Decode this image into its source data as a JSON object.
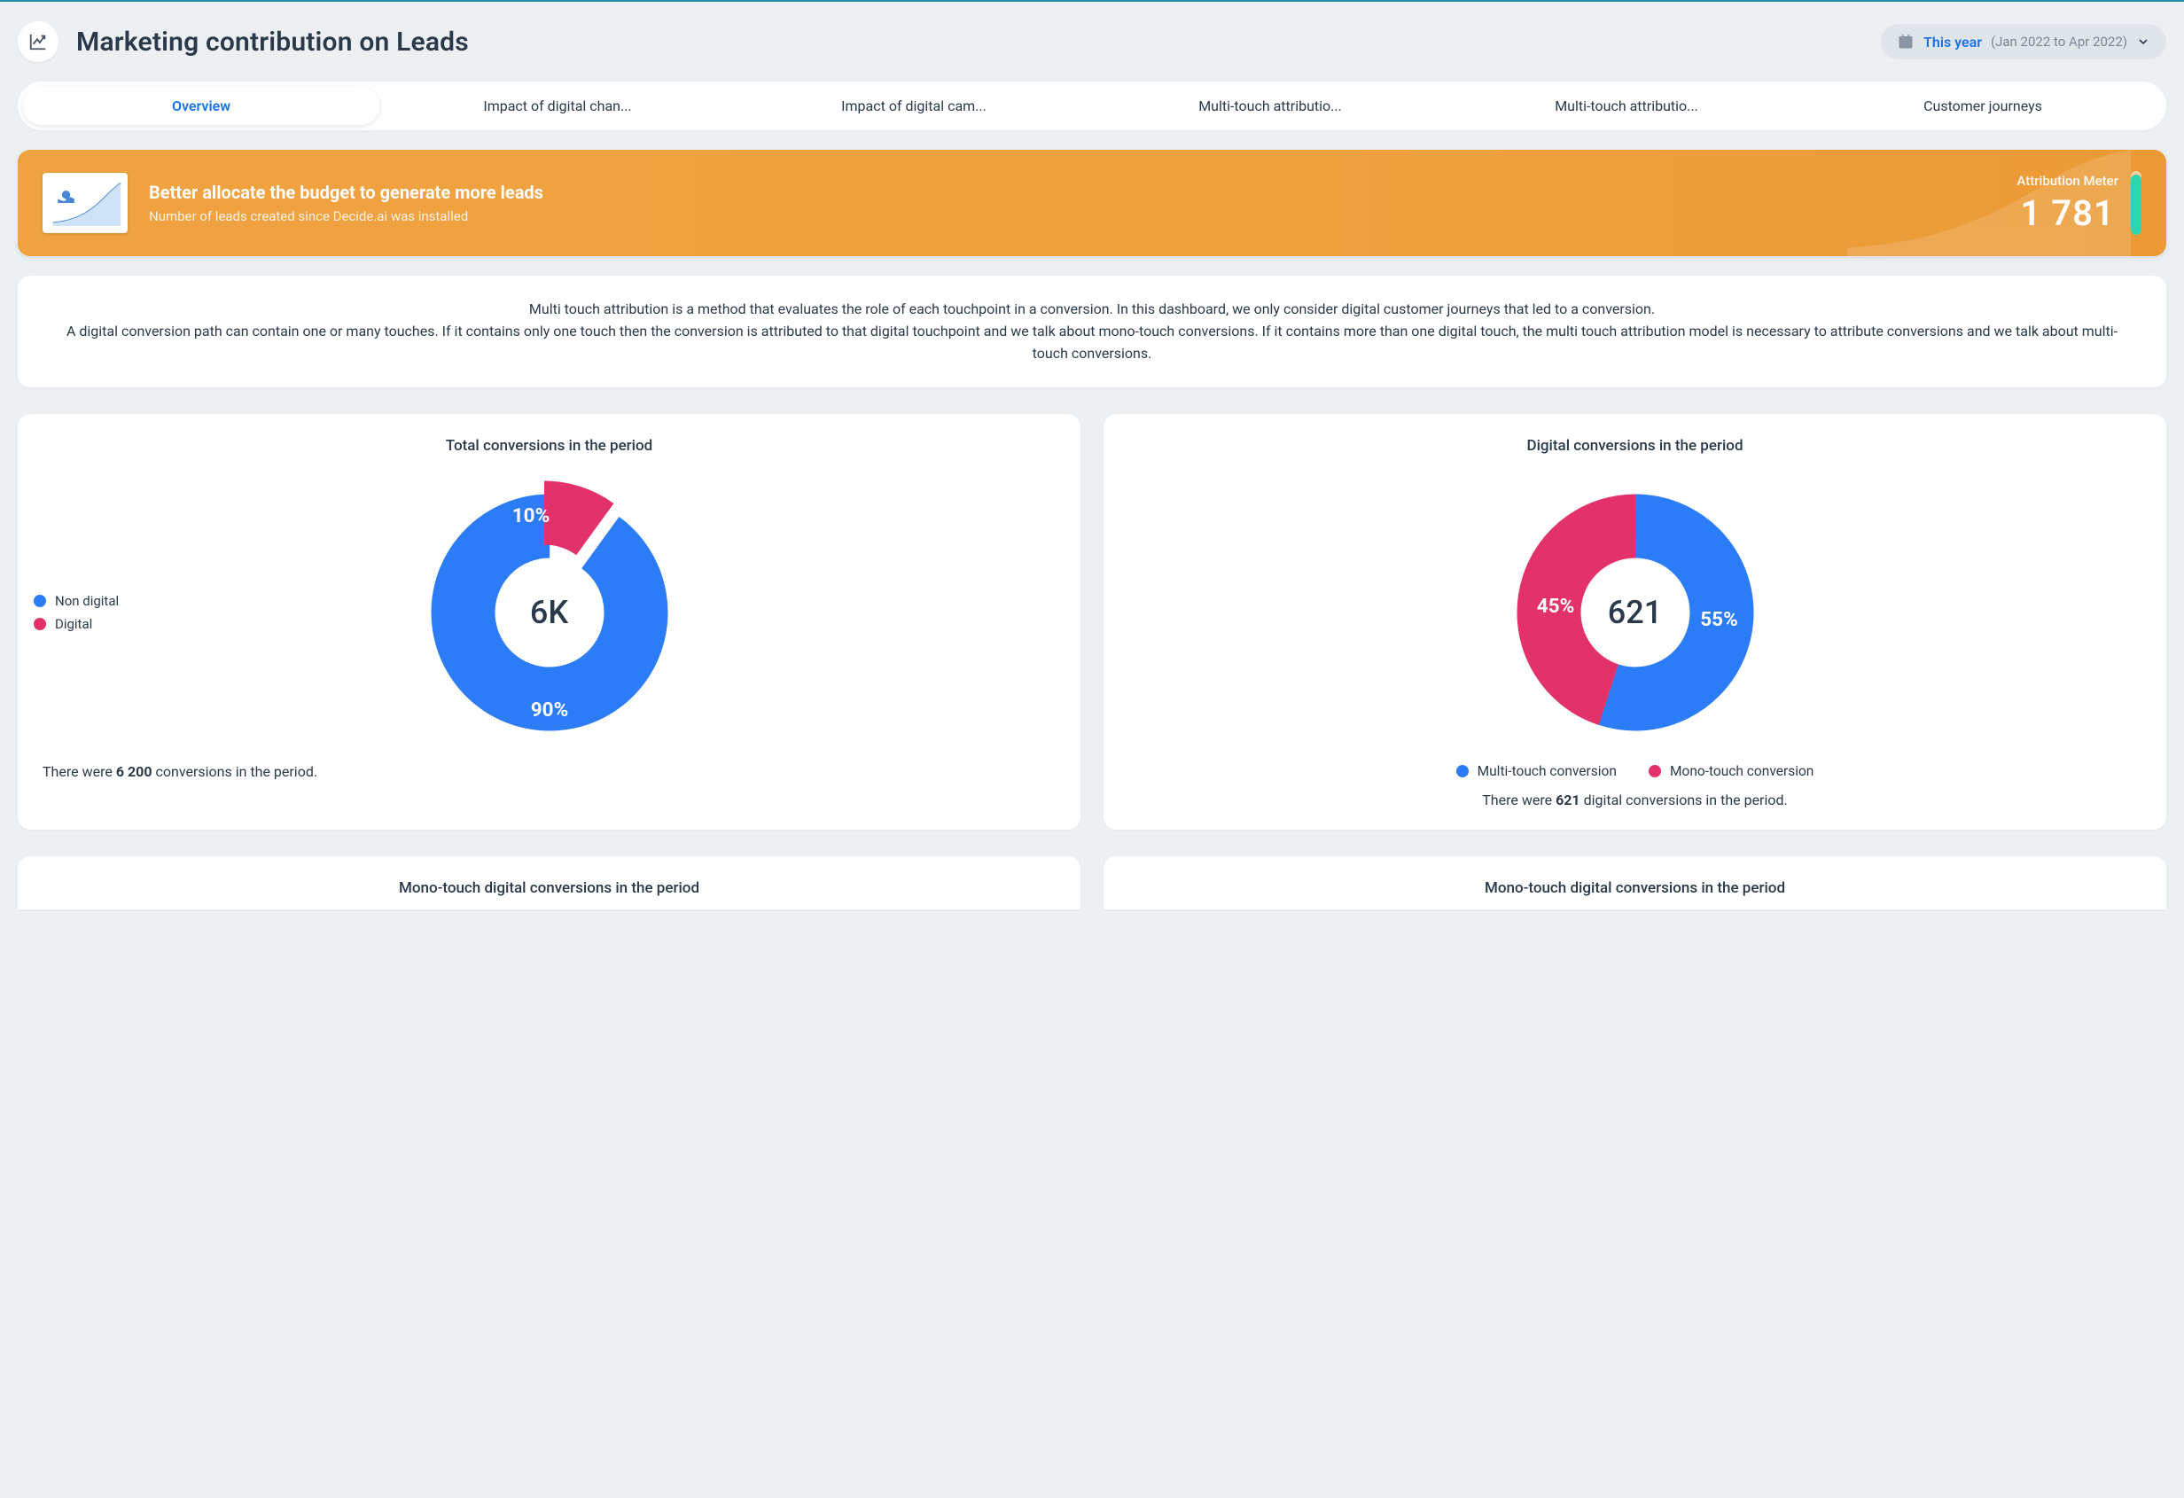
{
  "header": {
    "title": "Marketing contribution on Leads",
    "date_picker": {
      "label": "This year",
      "range": "(Jan 2022 to Apr 2022)"
    }
  },
  "tabs": [
    {
      "label": "Overview",
      "active": true
    },
    {
      "label": "Impact of digital chan..."
    },
    {
      "label": "Impact of digital cam..."
    },
    {
      "label": "Multi-touch attributio..."
    },
    {
      "label": "Multi-touch attributio..."
    },
    {
      "label": "Customer journeys"
    }
  ],
  "banner": {
    "title": "Better allocate the budget to generate more leads",
    "subtitle": "Number of leads created since Decide.ai was installed",
    "meter_label": "Attribution Meter",
    "meter_value": "1 781"
  },
  "intro": {
    "line1": "Multi touch attribution is a method that evaluates the role of each touchpoint in a conversion. In this dashboard, we only consider digital customer journeys that led to a conversion.",
    "line2": "A digital conversion path can contain one or many touches. If it contains only one touch then the conversion is attributed to that digital touchpoint and we talk about mono-touch conversions. If it contains more than one digital touch, the multi touch attribution model is necessary to attribute conversions and we talk about multi-touch conversions."
  },
  "cards": {
    "total": {
      "title": "Total conversions in the period",
      "center": "6K",
      "legend": [
        {
          "label": "Non digital",
          "color": "blue"
        },
        {
          "label": "Digital",
          "color": "pink"
        }
      ],
      "slice_labels": {
        "big": "90%",
        "small": "10%"
      },
      "footer_prefix": "There were ",
      "footer_bold": "6 200",
      "footer_suffix": " conversions in the period."
    },
    "digital": {
      "title": "Digital conversions in the period",
      "center": "621",
      "legend": [
        {
          "label": "Multi-touch conversion",
          "color": "blue"
        },
        {
          "label": "Mono-touch conversion",
          "color": "pink"
        }
      ],
      "slice_labels": {
        "big": "55%",
        "small": "45%"
      },
      "footer_prefix": "There were ",
      "footer_bold": "621",
      "footer_suffix": " digital conversions in the period."
    }
  },
  "lower_titles": {
    "left": "Mono-touch digital conversions in the period",
    "right": "Mono-touch digital conversions in the period"
  },
  "chart_data": [
    {
      "type": "pie",
      "title": "Total conversions in the period",
      "series": [
        {
          "name": "Non digital",
          "value": 90,
          "color": "#2b7cf6"
        },
        {
          "name": "Digital",
          "value": 10,
          "color": "#e3326a"
        }
      ],
      "total": 6200,
      "center_label": "6K"
    },
    {
      "type": "pie",
      "title": "Digital conversions in the period",
      "series": [
        {
          "name": "Multi-touch conversion",
          "value": 55,
          "color": "#2b7cf6"
        },
        {
          "name": "Mono-touch conversion",
          "value": 45,
          "color": "#e3326a"
        }
      ],
      "total": 621,
      "center_label": "621"
    }
  ]
}
